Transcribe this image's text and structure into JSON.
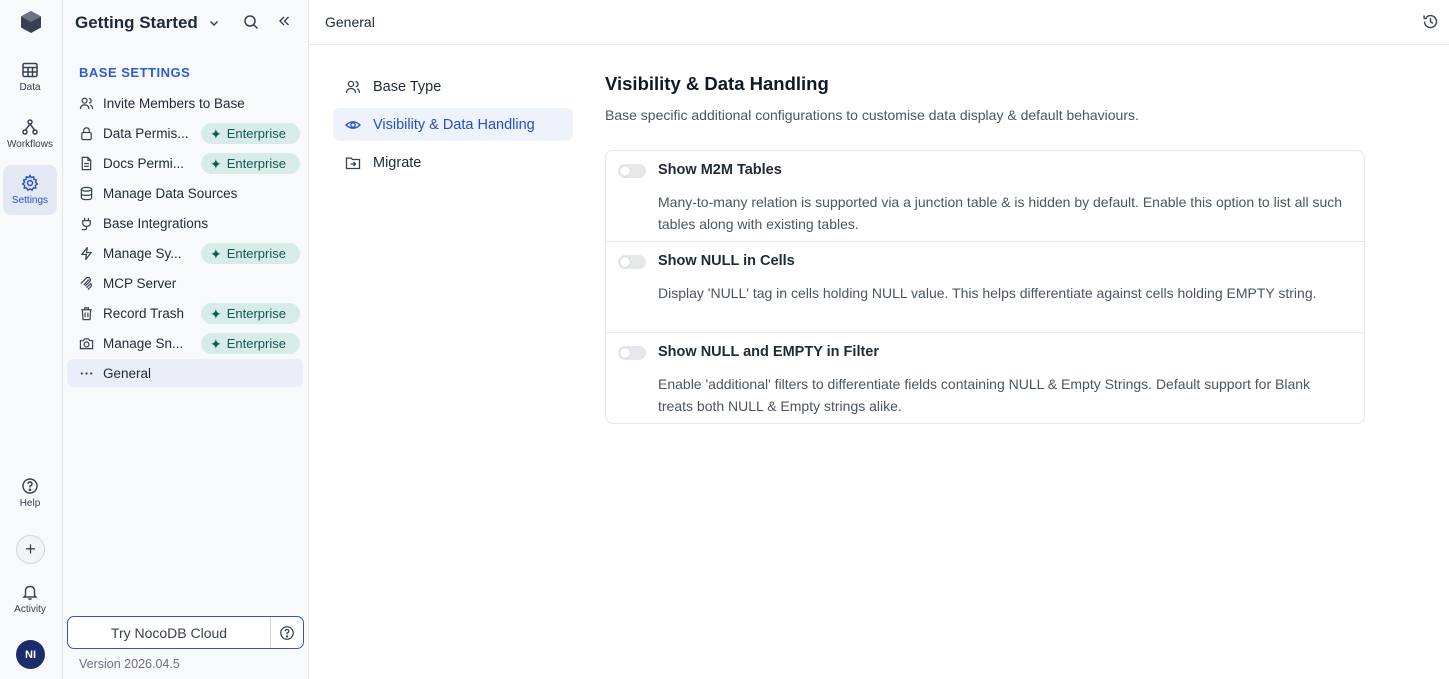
{
  "rail": {
    "items": [
      {
        "label": "Data",
        "icon": "table-icon"
      },
      {
        "label": "Workflows",
        "icon": "workflow-icon"
      },
      {
        "label": "Settings",
        "icon": "gear-icon"
      },
      {
        "label": "Help",
        "icon": "help-circle-icon"
      },
      {
        "label": "Activity",
        "icon": "bell-icon"
      }
    ],
    "avatar": "NI",
    "plus": "+"
  },
  "sidebar": {
    "title": "Getting Started",
    "section": "BASE SETTINGS",
    "items": [
      {
        "label": "Invite Members to Base",
        "icon": "users-icon",
        "badge": null
      },
      {
        "label": "Data Permis...",
        "icon": "lock-icon",
        "badge": "Enterprise"
      },
      {
        "label": "Docs Permi...",
        "icon": "document-icon",
        "badge": "Enterprise"
      },
      {
        "label": "Manage Data Sources",
        "icon": "database-icon",
        "badge": null
      },
      {
        "label": "Base Integrations",
        "icon": "plug-icon",
        "badge": null
      },
      {
        "label": "Manage Sy...",
        "icon": "lightning-icon",
        "badge": "Enterprise"
      },
      {
        "label": "MCP Server",
        "icon": "mcp-icon",
        "badge": null
      },
      {
        "label": "Record Trash",
        "icon": "trash-icon",
        "badge": null,
        "badge2": "Enterprise"
      },
      {
        "label": "Manage Sn...",
        "icon": "camera-icon",
        "badge": "Enterprise"
      },
      {
        "label": "General",
        "icon": "more-icon",
        "badge": null
      }
    ],
    "cloud_button": "Try NocoDB Cloud",
    "version": "Version 2026.04.5"
  },
  "topbar": {
    "title": "General"
  },
  "subnav": [
    {
      "label": "Base Type",
      "icon": "users-icon"
    },
    {
      "label": "Visibility & Data Handling",
      "icon": "eye-icon"
    },
    {
      "label": "Migrate",
      "icon": "migrate-icon"
    }
  ],
  "content": {
    "title": "Visibility & Data Handling",
    "subtitle": "Base specific additional configurations to customise data display & default behaviours.",
    "options": [
      {
        "title": "Show M2M Tables",
        "desc": "Many-to-many relation is supported via a junction table & is hidden by default. Enable this option to list all such tables along with existing tables.",
        "enabled": false
      },
      {
        "title": "Show NULL in Cells",
        "desc": "Display 'NULL' tag in cells holding NULL value. This helps differentiate against cells holding EMPTY string.",
        "enabled": false
      },
      {
        "title": "Show NULL and EMPTY in Filter",
        "desc": "Enable 'additional' filters to differentiate fields containing NULL & Empty Strings. Default support for Blank treats both NULL & Empty strings alike.",
        "enabled": false
      }
    ]
  },
  "colors": {
    "accent": "#2450c4",
    "badge_bg": "#d7ece9",
    "badge_text": "#0f5a52"
  }
}
